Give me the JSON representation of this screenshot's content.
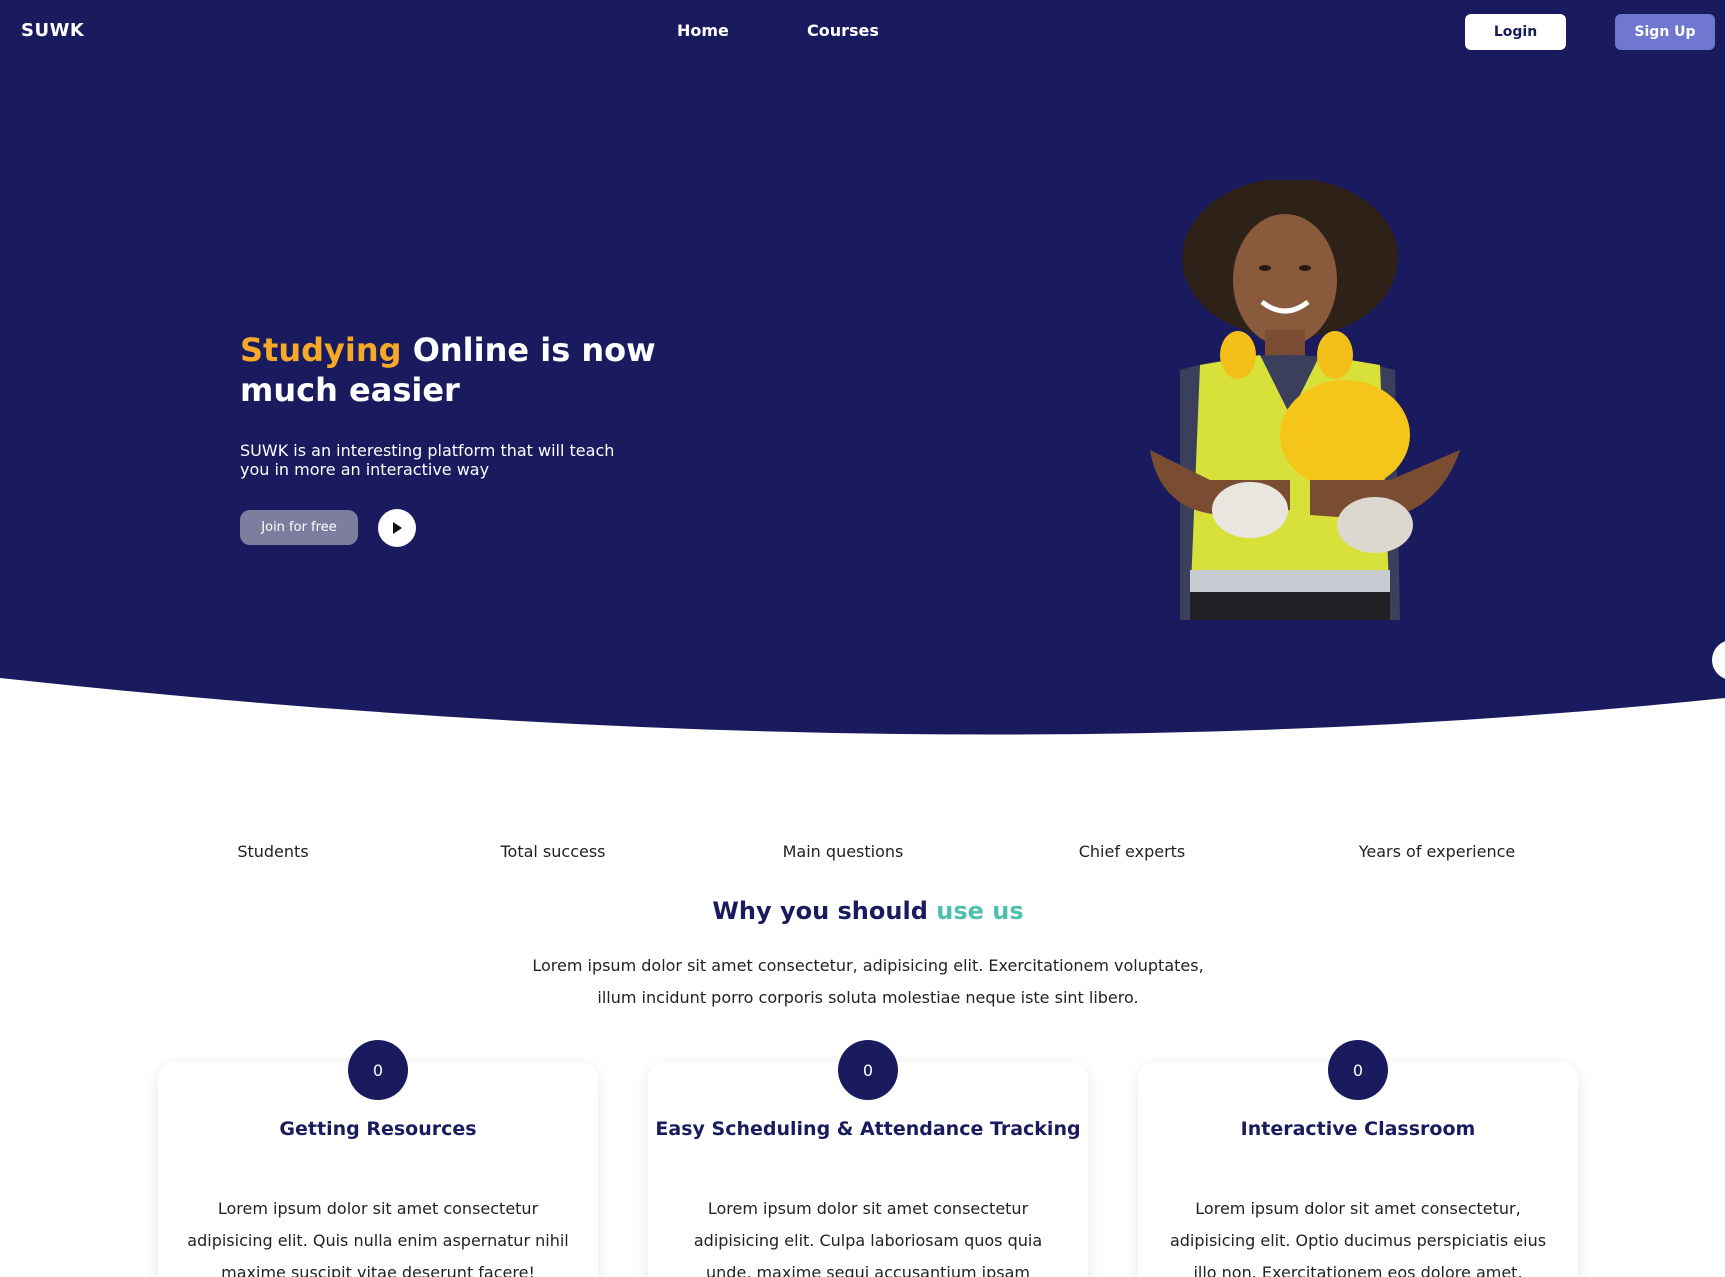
{
  "header": {
    "logo": "SUWK",
    "nav": [
      {
        "label": "Home"
      },
      {
        "label": "Courses"
      }
    ],
    "login_label": "Login",
    "signup_label": "Sign Up"
  },
  "hero": {
    "title_accent": "Studying",
    "title_rest": " Online is now much easier",
    "subtitle": "SUWK is an interesting platform that will teach you in more an interactive way",
    "join_label": "Join for free",
    "play_icon": "play-icon"
  },
  "stats": [
    {
      "label": "Students"
    },
    {
      "label": "Total success"
    },
    {
      "label": "Main questions"
    },
    {
      "label": "Chief experts"
    },
    {
      "label": "Years of experience"
    }
  ],
  "why": {
    "title_main": "Why you should ",
    "title_accent": "use us",
    "description": "Lorem ipsum dolor sit amet consectetur, adipisicing elit. Exercitationem voluptates, illum incidunt porro corporis soluta molestiae neque iste sint libero."
  },
  "features": [
    {
      "badge": "0",
      "title": "Getting Resources",
      "text": "Lorem ipsum dolor sit amet consectetur adipisicing elit. Quis nulla enim aspernatur nihil maxime suscipit vitae deserunt facere!"
    },
    {
      "badge": "0",
      "title": "Easy Scheduling & Attendance Tracking",
      "text": "Lorem ipsum dolor sit amet consectetur adipisicing elit. Culpa laboriosam quos quia unde, maxime sequi accusantium ipsam excepturi?"
    },
    {
      "badge": "0",
      "title": "Interactive Classroom",
      "text": "Lorem ipsum dolor sit amet consectetur, adipisicing elit. Optio ducimus perspiciatis eius illo non. Exercitationem eos dolore amet."
    }
  ],
  "colors": {
    "navy": "#1a1b5e",
    "accent_orange": "#f6a829",
    "accent_teal": "#4fc0ad",
    "signup_purple": "#6f77d0"
  }
}
